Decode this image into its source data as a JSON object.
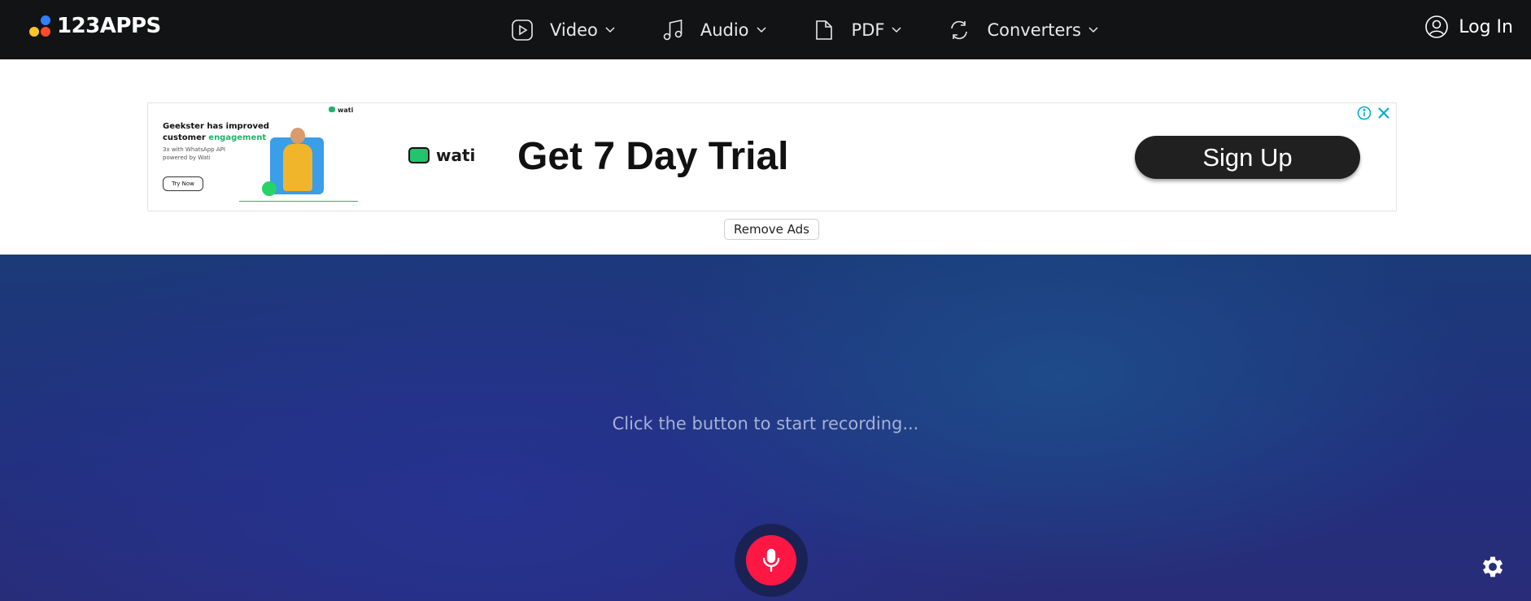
{
  "header": {
    "logo_text": "123APPS",
    "nav": [
      {
        "label": "Video",
        "icon": "video-icon"
      },
      {
        "label": "Audio",
        "icon": "music-note-icon"
      },
      {
        "label": "PDF",
        "icon": "document-icon"
      },
      {
        "label": "Converters",
        "icon": "convert-icon"
      }
    ],
    "login_label": "Log In"
  },
  "ad": {
    "small_headline_1": "Geekster has improved",
    "small_headline_2": "customer",
    "small_headline_highlight": "engagement",
    "small_tiny_1": "3x with WhatsApp API",
    "small_tiny_2": "powered by Wati",
    "small_try": "Try Now",
    "mini_brand": "wati",
    "brand": "wati",
    "headline": "Get 7 Day Trial",
    "cta": "Sign Up"
  },
  "remove_ads_label": "Remove Ads",
  "recorder": {
    "status_text": "Click the button to start recording..."
  },
  "colors": {
    "topbar": "#121314",
    "mic_button": "#ff1744",
    "highlight_green": "#1fb26b"
  }
}
